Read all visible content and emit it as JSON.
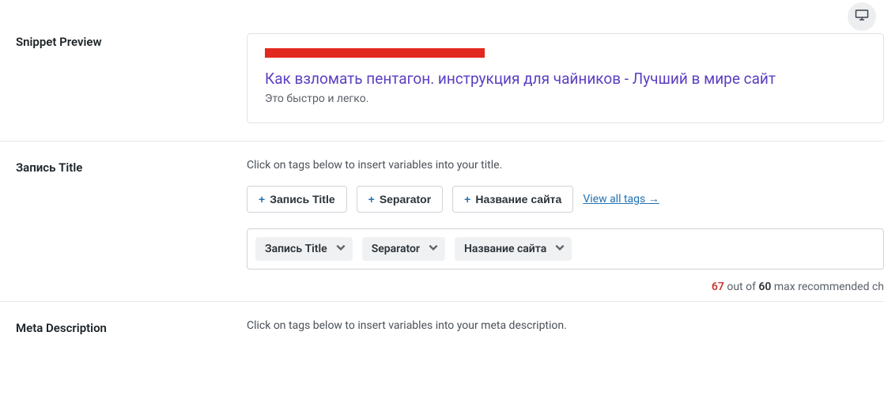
{
  "snippet": {
    "label": "Snippet Preview",
    "title": "Как взломать пентагон. инструкция для чайников - Лучший в мире сайт",
    "description": "Это быстро и легко."
  },
  "titleSection": {
    "label": "Запись Title",
    "hint": "Click on tags below to insert variables into your title.",
    "tags": {
      "t1": "Запись Title",
      "t2": "Separator",
      "t3": "Название сайта"
    },
    "viewAll": "View all tags →",
    "chips": {
      "c1": "Запись Title",
      "c2": "Separator",
      "c3": "Название сайта"
    },
    "counter": {
      "current": "67",
      "mid": " out of ",
      "max": "60",
      "tail": " max recommended ch"
    }
  },
  "metaSection": {
    "label": "Meta Description",
    "hint": "Click on tags below to insert variables into your meta description."
  }
}
